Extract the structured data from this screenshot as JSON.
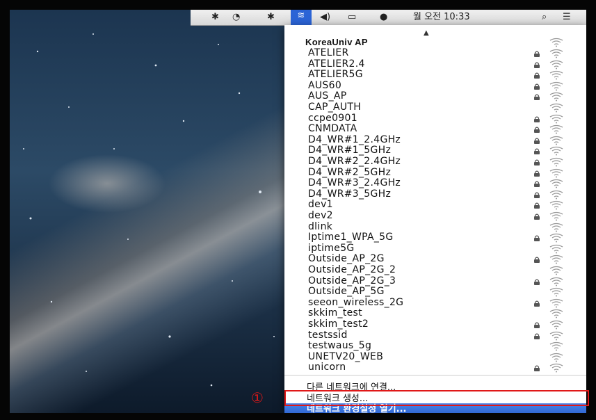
{
  "menubar": {
    "clock": "월 오전 10:33"
  },
  "wifi_menu": {
    "current_network": "KoreaUniv AP",
    "networks": [
      {
        "name": "ATELIER",
        "locked": true
      },
      {
        "name": "ATELIER2.4",
        "locked": true
      },
      {
        "name": "ATELIER5G",
        "locked": true
      },
      {
        "name": "AUS60",
        "locked": true
      },
      {
        "name": "AUS_AP",
        "locked": true
      },
      {
        "name": "CAP_AUTH",
        "locked": false
      },
      {
        "name": "ccpe0901",
        "locked": true
      },
      {
        "name": "CNMDATA",
        "locked": true
      },
      {
        "name": "D4_WR#1_2.4GHz",
        "locked": true
      },
      {
        "name": "D4_WR#1_5GHz",
        "locked": true
      },
      {
        "name": "D4_WR#2_2.4GHz",
        "locked": true
      },
      {
        "name": "D4_WR#2_5GHz",
        "locked": true
      },
      {
        "name": "D4_WR#3_2.4GHz",
        "locked": true
      },
      {
        "name": "D4_WR#3_5GHz",
        "locked": true
      },
      {
        "name": "dev1",
        "locked": true
      },
      {
        "name": "dev2",
        "locked": true
      },
      {
        "name": "dlink",
        "locked": false
      },
      {
        "name": "Iptime1_WPA_5G",
        "locked": true
      },
      {
        "name": "iptime5G",
        "locked": false
      },
      {
        "name": "Outside_AP_2G",
        "locked": true
      },
      {
        "name": "Outside_AP_2G_2",
        "locked": false
      },
      {
        "name": "Outside_AP_2G_3",
        "locked": true
      },
      {
        "name": "Outside_AP_5G",
        "locked": false
      },
      {
        "name": "seeon_wireless_2G",
        "locked": true
      },
      {
        "name": "skkim_test",
        "locked": false
      },
      {
        "name": "skkim_test2",
        "locked": true
      },
      {
        "name": "testssid",
        "locked": true
      },
      {
        "name": "testwaus_5g",
        "locked": false
      },
      {
        "name": "UNETV20_WEB",
        "locked": false
      },
      {
        "name": "unicorn",
        "locked": true
      }
    ],
    "actions": {
      "join_other": "다른 네트워크에 연결...",
      "create_network": "네트워크 생성...",
      "open_prefs": "네트워크 환경설정 열기..."
    }
  },
  "annotation": {
    "marker": "①",
    "color": "#e01818"
  }
}
